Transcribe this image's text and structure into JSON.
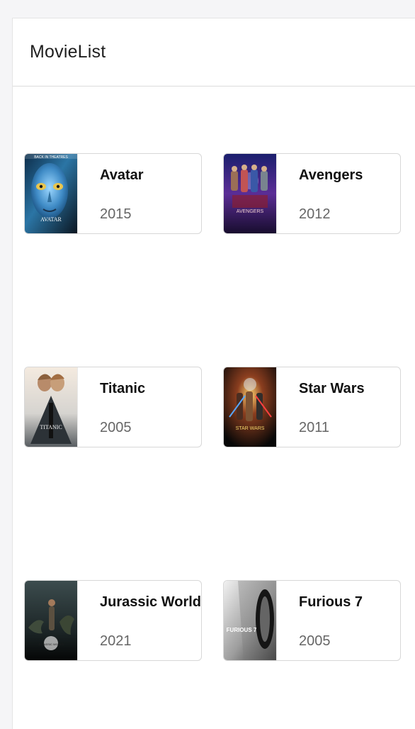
{
  "header": {
    "title": "MovieList"
  },
  "colors": {
    "page_background": "#f5f5f7",
    "card_border": "#d7d7d7",
    "title_text": "#111111",
    "year_text": "#666666"
  },
  "movies": [
    {
      "title": "Avatar",
      "year": "2015",
      "poster_icon": "avatar-poster",
      "poster_text": "AVATAR",
      "poster_top_text": "BACK IN THEATRES"
    },
    {
      "title": "Avengers",
      "year": "2012",
      "poster_icon": "avengers-poster",
      "poster_text": "AVENGERS"
    },
    {
      "title": "Titanic",
      "year": "2005",
      "poster_icon": "titanic-poster",
      "poster_text": "TITANIC"
    },
    {
      "title": "Star Wars",
      "year": "2011",
      "poster_icon": "star-wars-poster",
      "poster_text": "STAR WARS"
    },
    {
      "title": "Jurassic World",
      "year": "2021",
      "poster_icon": "jurassic-world-poster",
      "poster_text": "JURASSIC WORLD"
    },
    {
      "title": "Furious 7",
      "year": "2005",
      "poster_icon": "furious-7-poster",
      "poster_text": "FURIOUS 7"
    }
  ]
}
